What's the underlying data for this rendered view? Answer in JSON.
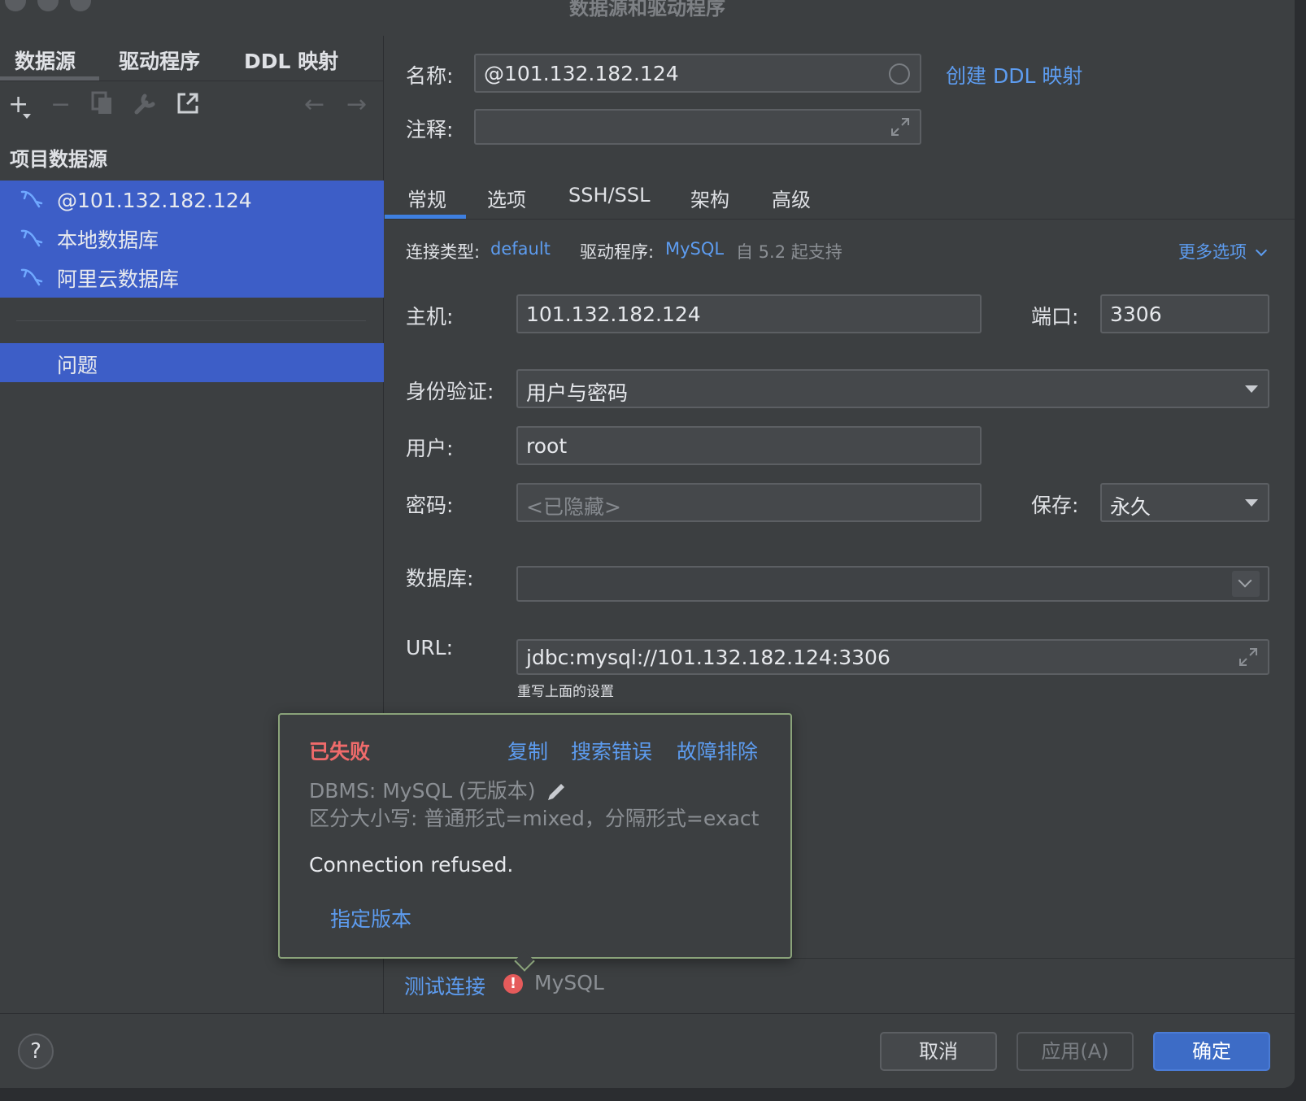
{
  "window": {
    "title": "数据源和驱动程序"
  },
  "left_tabs": [
    "数据源",
    "驱动程序",
    "DDL 映射"
  ],
  "toolbar": {
    "add": "+",
    "remove": "−",
    "back": "←",
    "forward": "→"
  },
  "sidebar": {
    "section_title": "项目数据源",
    "items": [
      "@101.132.182.124",
      "本地数据库",
      "阿里云数据库"
    ],
    "problems_label": "问题"
  },
  "form": {
    "name_label": "名称:",
    "name_value": "@101.132.182.124",
    "create_ddl_link": "创建 DDL 映射",
    "comment_label": "注释:",
    "comment_value": ""
  },
  "tabs": [
    "常规",
    "选项",
    "SSH/SSL",
    "架构",
    "高级"
  ],
  "general": {
    "conn_type_label": "连接类型:",
    "conn_type_value": "default",
    "driver_label": "驱动程序:",
    "driver_value": "MySQL",
    "driver_note": "自 5.2 起支持",
    "more_options": "更多选项",
    "host_label": "主机:",
    "host_value": "101.132.182.124",
    "port_label": "端口:",
    "port_value": "3306",
    "auth_label": "身份验证:",
    "auth_value": "用户与密码",
    "user_label": "用户:",
    "user_value": "root",
    "password_label": "密码:",
    "password_placeholder": "<已隐藏>",
    "save_label": "保存:",
    "save_value": "永久",
    "database_label": "数据库:",
    "database_value": "",
    "url_label": "URL:",
    "url_value": "jdbc:mysql://101.132.182.124:3306",
    "url_hint": "重写上面的设置"
  },
  "test": {
    "test_link": "测试连接",
    "driver_name": "MySQL"
  },
  "popup": {
    "status": "已失败",
    "copy": "复制",
    "search_error": "搜索错误",
    "troubleshoot": "故障排除",
    "dbms_line": "DBMS: MySQL (无版本)",
    "case_line": "区分大小写: 普通形式=mixed，分隔形式=exact",
    "message": "Connection refused.",
    "specify_version": "指定版本"
  },
  "footer": {
    "help": "?",
    "cancel": "取消",
    "apply": "应用(A)",
    "ok": "确定"
  },
  "colors": {
    "accent": "#5d9cf0",
    "selection": "#3d5ec7",
    "error": "#f06b6b",
    "primary_button": "#3d6cc6"
  }
}
